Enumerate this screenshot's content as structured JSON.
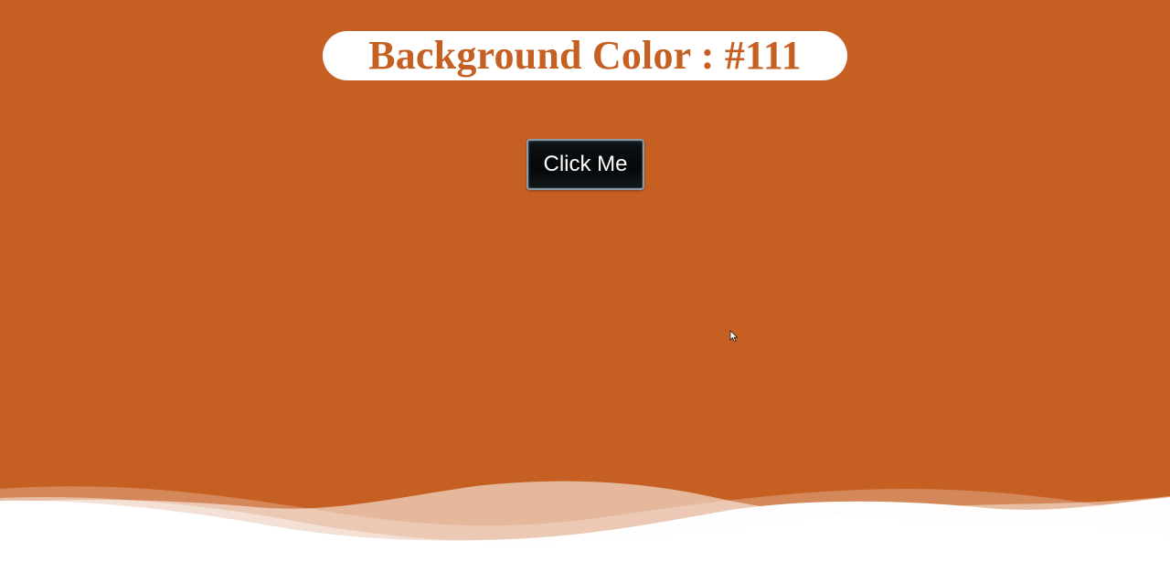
{
  "page": {
    "title": "Background Color : #111",
    "button_label": "Click Me"
  },
  "colors": {
    "background": "#c65f22",
    "title_pill": "#ffffff",
    "title_text": "#c65f22",
    "button_background": "#07090b",
    "button_text": "#ffffff",
    "wave": "#ffffff"
  },
  "icons": {
    "pointer": "mouse-pointer-icon"
  }
}
